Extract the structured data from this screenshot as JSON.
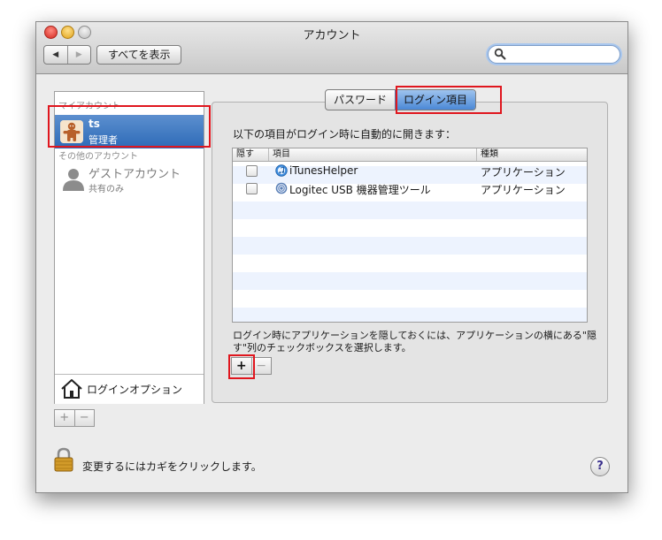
{
  "window": {
    "title": "アカウント"
  },
  "toolbar": {
    "back_glyph": "◀",
    "forward_glyph": "▶",
    "show_all": "すべてを表示",
    "search_placeholder": ""
  },
  "sidebar": {
    "my_account_label": "マイアカウント",
    "selected_user": {
      "name": "ts",
      "role": "管理者"
    },
    "other_accounts_label": "その他のアカウント",
    "guest": {
      "name": "ゲストアカウント",
      "role": "共有のみ"
    },
    "login_options": "ログインオプション",
    "add_glyph": "+",
    "remove_glyph": "−"
  },
  "tabs": {
    "password": "パスワード",
    "login_items": "ログイン項目",
    "active": "login_items"
  },
  "login_items": {
    "prompt": "以下の項目がログイン時に自動的に開きます：",
    "columns": {
      "hide": "隠す",
      "item": "項目",
      "kind": "種類"
    },
    "rows": [
      {
        "name": "iTunesHelper",
        "kind": "アプリケーション",
        "hidden": false,
        "icon": "itunes-icon"
      },
      {
        "name": "Logitec USB 機器管理ツール",
        "kind": "アプリケーション",
        "hidden": false,
        "icon": "logitec-icon"
      }
    ],
    "note": "ログイン時にアプリケーションを隠しておくには、アプリケーションの横にある\"隠す\"列のチェックボックスを選択します。",
    "add_glyph": "+",
    "remove_glyph": "−"
  },
  "footer": {
    "lock_text": "変更するにはカギをクリックします。",
    "help_glyph": "?"
  },
  "colors": {
    "highlight": "#e0161e",
    "selection": "#3b78c3"
  }
}
